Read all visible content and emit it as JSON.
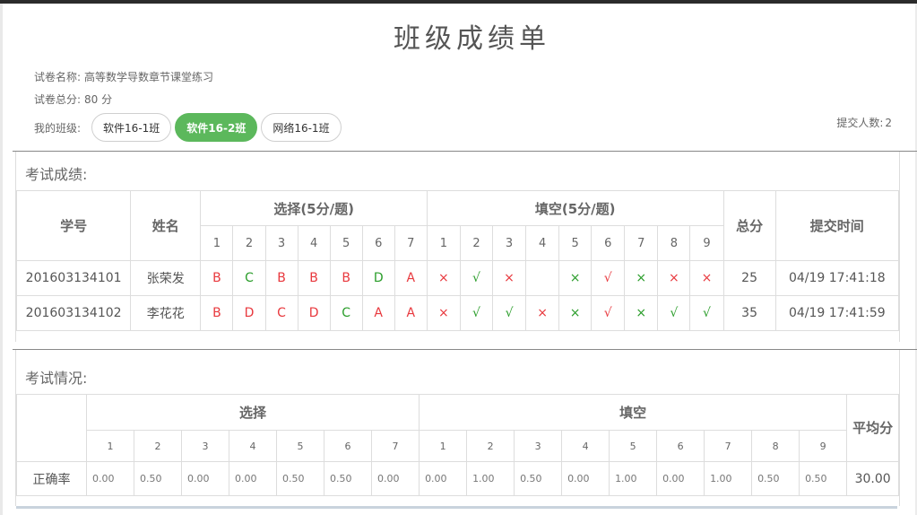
{
  "title": "班级成绩单",
  "exam_name_label": "试卷名称:",
  "exam_name": "高等数学导数章节课堂练习",
  "total_score_label": "试卷总分:",
  "total_score": "80 分",
  "class_label": "我的班级:",
  "classes": [
    {
      "label": "软件16-1班",
      "active": false
    },
    {
      "label": "软件16-2班",
      "active": true
    },
    {
      "label": "网络16-1班",
      "active": false
    }
  ],
  "submit_count_label": "提交人数:",
  "submit_count": "2",
  "scores": {
    "section_title": "考试成绩:",
    "headers": {
      "student_id": "学号",
      "name": "姓名",
      "choice": "选择(5分/题)",
      "blank": "填空(5分/题)",
      "total": "总分",
      "submit_time": "提交时间"
    },
    "choice_numbers": [
      "1",
      "2",
      "3",
      "4",
      "5",
      "6",
      "7"
    ],
    "blank_numbers": [
      "1",
      "2",
      "3",
      "4",
      "5",
      "6",
      "7",
      "8",
      "9"
    ],
    "rows": [
      {
        "student_id": "201603134101",
        "name": "张荣发",
        "choice": [
          {
            "v": "B",
            "ok": false
          },
          {
            "v": "C",
            "ok": true
          },
          {
            "v": "B",
            "ok": false
          },
          {
            "v": "B",
            "ok": false
          },
          {
            "v": "B",
            "ok": false
          },
          {
            "v": "D",
            "ok": true
          },
          {
            "v": "A",
            "ok": false
          }
        ],
        "blank": [
          {
            "v": "×",
            "c": "red"
          },
          {
            "v": "√",
            "c": "green"
          },
          {
            "v": "×",
            "c": "red"
          },
          {
            "v": "",
            "c": ""
          },
          {
            "v": "×",
            "c": "green"
          },
          {
            "v": "√",
            "c": "red"
          },
          {
            "v": "×",
            "c": "green"
          },
          {
            "v": "×",
            "c": "red"
          },
          {
            "v": "×",
            "c": "red"
          }
        ],
        "total": "25",
        "submit_time": "04/19 17:41:18"
      },
      {
        "student_id": "201603134102",
        "name": "李花花",
        "choice": [
          {
            "v": "B",
            "ok": false
          },
          {
            "v": "D",
            "ok": false
          },
          {
            "v": "C",
            "ok": false
          },
          {
            "v": "D",
            "ok": false
          },
          {
            "v": "C",
            "ok": true
          },
          {
            "v": "A",
            "ok": false
          },
          {
            "v": "A",
            "ok": false
          }
        ],
        "blank": [
          {
            "v": "×",
            "c": "red"
          },
          {
            "v": "√",
            "c": "green"
          },
          {
            "v": "√",
            "c": "green"
          },
          {
            "v": "×",
            "c": "red"
          },
          {
            "v": "×",
            "c": "green"
          },
          {
            "v": "√",
            "c": "red"
          },
          {
            "v": "×",
            "c": "green"
          },
          {
            "v": "√",
            "c": "green"
          },
          {
            "v": "√",
            "c": "green"
          }
        ],
        "total": "35",
        "submit_time": "04/19 17:41:59"
      }
    ]
  },
  "stats": {
    "section_title": "考试情况:",
    "choice_header": "选择",
    "blank_header": "填空",
    "average_header": "平均分",
    "accuracy_label": "正确率",
    "choice_rates": [
      "0.00",
      "0.50",
      "0.00",
      "0.00",
      "0.50",
      "0.50",
      "0.00"
    ],
    "blank_rates": [
      "0.00",
      "1.00",
      "0.50",
      "0.00",
      "1.00",
      "0.00",
      "1.00",
      "0.50",
      "0.50"
    ],
    "average": "30.00"
  },
  "colors": {
    "accent": "#5cb85c",
    "wrong": "#e8383d",
    "right": "#2a9d2a"
  }
}
